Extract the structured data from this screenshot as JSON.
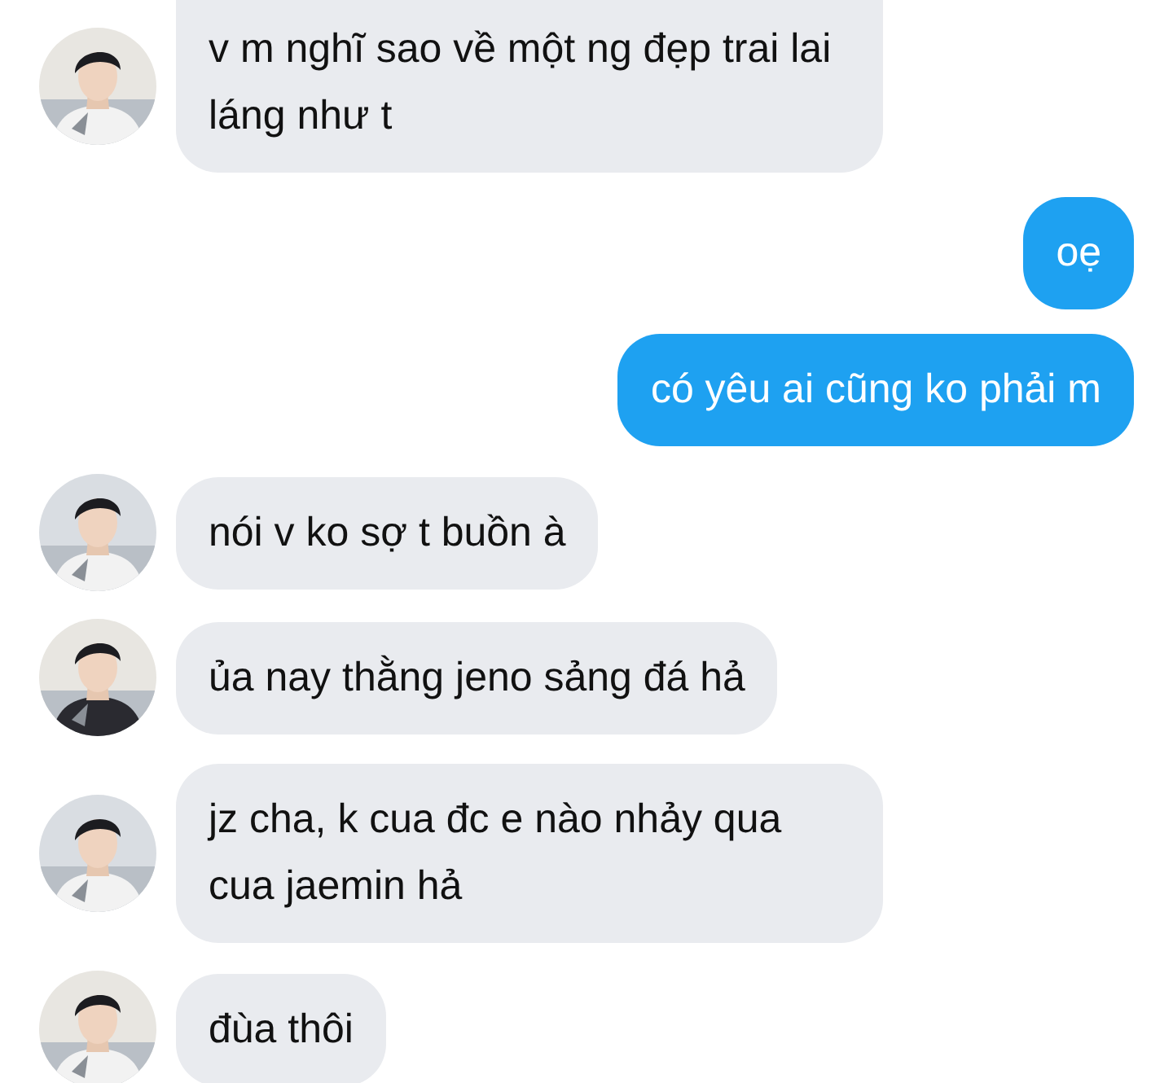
{
  "messages": [
    {
      "kind": "incoming",
      "text": "v m nghĩ sao về một ng đẹp trai lai láng như t"
    },
    {
      "kind": "outgoing",
      "text": "oẹ"
    },
    {
      "kind": "outgoing",
      "text": "có yêu ai cũng ko phải m"
    },
    {
      "kind": "incoming",
      "text": "nói v ko sợ t buồn à"
    },
    {
      "kind": "incoming",
      "text": "ủa nay thằng jeno sảng đá hả"
    },
    {
      "kind": "incoming",
      "text": "jz cha, k cua đc e nào nhảy qua cua jaemin hả"
    },
    {
      "kind": "incoming",
      "text": "đùa thôi"
    }
  ]
}
